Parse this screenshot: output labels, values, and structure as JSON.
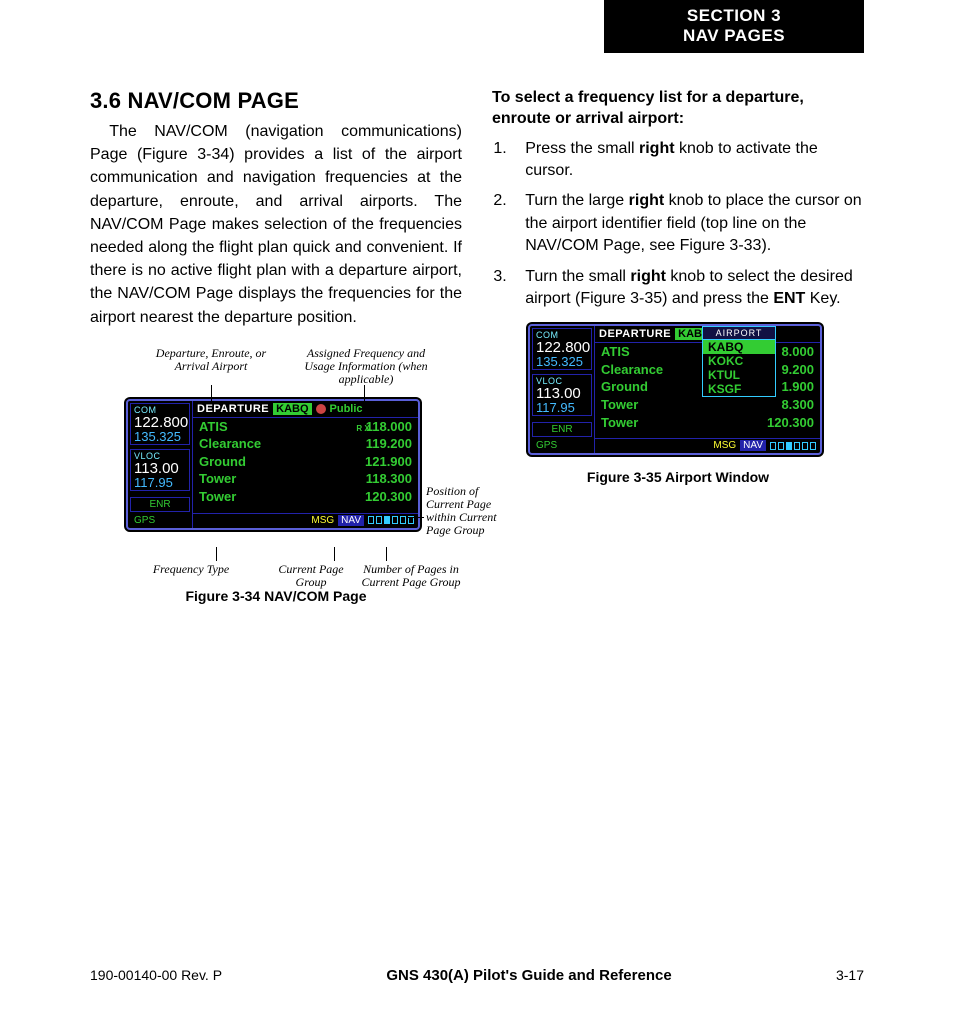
{
  "section_tab": {
    "line1": "SECTION 3",
    "line2": "NAV PAGES"
  },
  "left": {
    "heading": "3.6  NAV/COM PAGE",
    "paragraph": "The NAV/COM (navigation communications) Page (Figure 3-34) provides a list of the airport communication and navigation frequencies at the departure, enroute, and arrival airports.  The NAV/COM Page makes selection of the frequencies needed along the flight plan quick and convenient.  If there is no active flight plan with a departure airport, the NAV/COM Page displays the frequencies for the airport nearest the departure position.",
    "annotations": {
      "top_left": "Departure, Enroute, or Arrival Airport",
      "top_right": "Assigned Frequency and Usage Information (when applicable)",
      "right": "Position of Current Page within Current Page Group",
      "bottom_left": "Frequency Type",
      "bottom_mid": "Current Page Group",
      "bottom_right": "Number of Pages in Current Page Group"
    },
    "fig34_caption": "Figure 3-34  NAV/COM Page"
  },
  "right": {
    "howto_title": "To select a frequency list for a departure, enroute or arrival airport:",
    "steps": [
      {
        "pre": "Press the small ",
        "b": "right",
        "post": " knob to activate the cursor."
      },
      {
        "pre": "Turn the large ",
        "b": "right",
        "post": " knob to place the cursor on the airport identifier field (top line on the NAV/COM Page, see Figure 3-33)."
      },
      {
        "pre": "Turn the small ",
        "b": "right",
        "mid": " knob to select the desired airport (Figure 3-35) and press the ",
        "b2": "ENT",
        "post": " Key."
      }
    ],
    "fig35_caption": "Figure 3-35  Airport Window"
  },
  "gps": {
    "com_label": "COM",
    "com_active": "122.800",
    "com_standby": "135.325",
    "vloc_label": "VLOC",
    "vloc_active": "113.00",
    "vloc_standby": "117.95",
    "enr": "ENR",
    "gps": "GPS",
    "header": {
      "dep": "DEPARTURE",
      "airport": "KABQ",
      "pub": "Public"
    },
    "rows": [
      {
        "name": "ATIS",
        "rx": "R X",
        "freq": "118.000"
      },
      {
        "name": "Clearance",
        "freq": "119.200"
      },
      {
        "name": "Ground",
        "freq": "121.900"
      },
      {
        "name": "Tower",
        "freq": "118.300"
      },
      {
        "name": "Tower",
        "freq": "120.300"
      }
    ],
    "footer": {
      "msg": "MSG",
      "nav": "NAV"
    }
  },
  "gps35": {
    "popup_title": "AIRPORT",
    "popup_items": [
      "KABQ",
      "KOKC",
      "KTUL",
      "KSGF"
    ],
    "rows": [
      {
        "name": "ATIS",
        "freq": "8.000"
      },
      {
        "name": "Clearance",
        "freq": "9.200"
      },
      {
        "name": "Ground",
        "freq": "1.900"
      },
      {
        "name": "Tower",
        "freq": "8.300"
      },
      {
        "name": "Tower",
        "freq": "120.300"
      }
    ]
  },
  "footer": {
    "left": "190-00140-00  Rev. P",
    "center": "GNS 430(A) Pilot's Guide and Reference",
    "right": "3-17"
  }
}
